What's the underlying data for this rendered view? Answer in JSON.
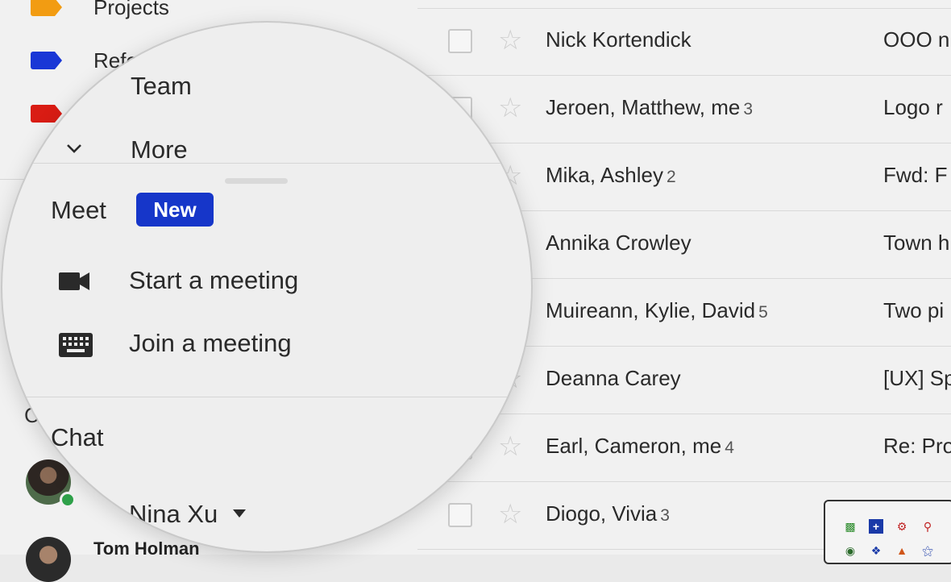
{
  "sidebar": {
    "labels": [
      {
        "text": "Projects",
        "color": "#f29c12"
      },
      {
        "text": "Refe",
        "color": "#1937d6"
      },
      {
        "text": "",
        "color": "#d91c14"
      }
    ],
    "chat_partial": "C",
    "contacts": [
      {
        "name": "Tom Holman"
      }
    ]
  },
  "magnifier": {
    "team": "Team",
    "more": "More",
    "meet_title": "Meet",
    "new_badge": "New",
    "start_meeting": "Start a meeting",
    "join_meeting": "Join a meeting",
    "chat_title": "Chat",
    "chat_user": "Nina Xu"
  },
  "emails": [
    {
      "sender": "Nick Kortendick",
      "count": "",
      "subject": "OOO n"
    },
    {
      "sender": "Jeroen, Matthew, me",
      "count": "3",
      "subject": "Logo r"
    },
    {
      "sender": "Mika, Ashley",
      "count": "2",
      "subject": "Fwd: F"
    },
    {
      "sender": "Annika Crowley",
      "count": "",
      "subject": "Town h"
    },
    {
      "sender": "Muireann, Kylie, David",
      "count": "5",
      "subject": "Two pi"
    },
    {
      "sender": "Deanna Carey",
      "count": "",
      "subject": "[UX] Sp"
    },
    {
      "sender": "Earl, Cameron, me",
      "count": "4",
      "subject": "Re: Pro"
    },
    {
      "sender": "Diogo, Vivia",
      "count": "3",
      "subject": ""
    }
  ],
  "icons": {
    "camera": "video-camera-icon",
    "keyboard": "keyboard-icon",
    "chevron": "chevron-down-icon",
    "star": "star-icon"
  },
  "colors": {
    "new_badge": "#1636c9",
    "presence": "#2fa14a"
  }
}
